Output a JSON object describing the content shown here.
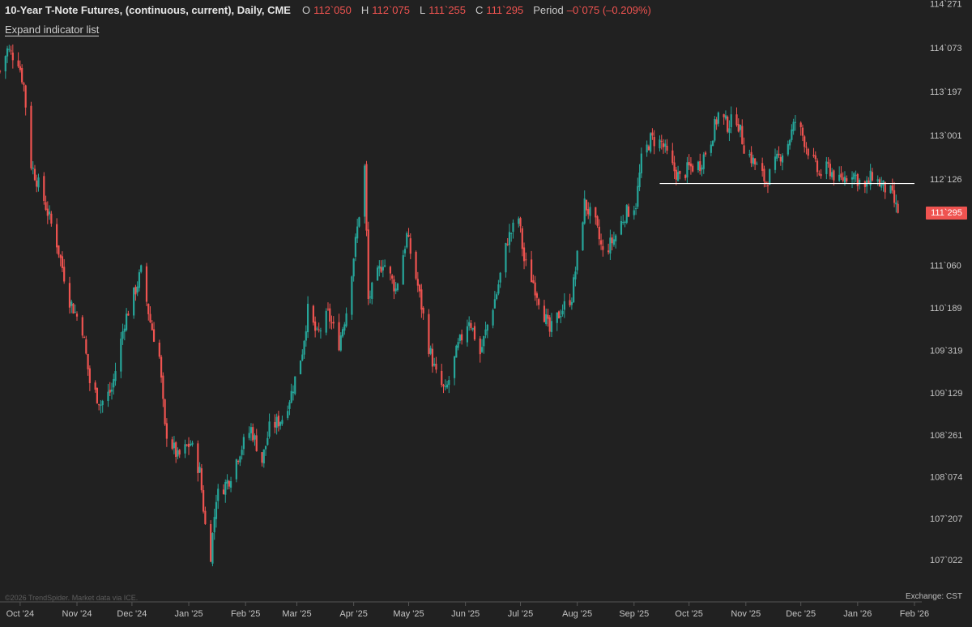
{
  "header": {
    "title": "10-Year T-Note Futures, (continuous, current), Daily, CME",
    "open_label": "O",
    "open_value": "112`050",
    "high_label": "H",
    "high_value": "112`075",
    "low_label": "L",
    "low_value": "111`255",
    "close_label": "C",
    "close_value": "111`295",
    "period_label": "Period",
    "period_value": "–0`075 (–0.209%)"
  },
  "toolbar": {
    "expand_label": "Expand indicator list"
  },
  "footer": {
    "copyright": "©2026 TrendSpider. Market data via ICE.",
    "exchange": "Exchange: CST"
  },
  "colors": {
    "background": "#212121",
    "up": "#26a69a",
    "down": "#ef5350",
    "grid_text": "#c4c4c4",
    "axis_line": "#555555",
    "support_line": "#ffffff"
  },
  "chart_data": {
    "type": "candlestick",
    "instrument": "10-Year T-Note Futures, (continuous, current), Daily, CME",
    "price_format": "points`32nds",
    "ylim": [
      106.9,
      114.42
    ],
    "y_ticks": [
      "114`271",
      "114`073",
      "113`197",
      "113`001",
      "112`126",
      "111`060",
      "110`189",
      "109`319",
      "109`129",
      "108`261",
      "108`074",
      "107`207",
      "107`022"
    ],
    "x_ticks": [
      "Oct '24",
      "Nov '24",
      "Dec '24",
      "Jan '25",
      "Feb '25",
      "Mar '25",
      "Apr '25",
      "May '25",
      "Jun '25",
      "Jul '25",
      "Aug '25",
      "Sep '25",
      "Oct '25",
      "Nov '25",
      "Dec '25",
      "Jan '26",
      "Feb '26"
    ],
    "x_range": [
      "2024-09-20",
      "2026-02-05"
    ],
    "last_price": "111`295",
    "last_price_value": 111.92,
    "support_line": {
      "price": 112.33,
      "from": "2025-09-15",
      "to": "2026-02-01"
    },
    "close_path": [
      [
        "2024-09-20",
        113.9
      ],
      [
        "2024-09-24",
        114.2
      ],
      [
        "2024-09-30",
        114.05
      ],
      [
        "2024-10-03",
        113.7
      ],
      [
        "2024-10-07",
        112.6
      ],
      [
        "2024-10-14",
        112.1
      ],
      [
        "2024-10-21",
        111.5
      ],
      [
        "2024-10-28",
        110.7
      ],
      [
        "2024-11-04",
        110.3
      ],
      [
        "2024-11-08",
        109.55
      ],
      [
        "2024-11-14",
        109.25
      ],
      [
        "2024-11-20",
        109.45
      ],
      [
        "2024-11-27",
        110.4
      ],
      [
        "2024-12-03",
        110.85
      ],
      [
        "2024-12-06",
        111.1
      ],
      [
        "2024-12-11",
        110.4
      ],
      [
        "2024-12-16",
        109.9
      ],
      [
        "2024-12-19",
        108.9
      ],
      [
        "2024-12-26",
        108.5
      ],
      [
        "2025-01-02",
        108.7
      ],
      [
        "2025-01-07",
        108.3
      ],
      [
        "2025-01-10",
        107.55
      ],
      [
        "2025-01-13",
        107.15
      ],
      [
        "2025-01-16",
        107.95
      ],
      [
        "2025-01-23",
        108.2
      ],
      [
        "2025-01-29",
        108.6
      ],
      [
        "2025-02-04",
        108.9
      ],
      [
        "2025-02-10",
        108.45
      ],
      [
        "2025-02-14",
        108.9
      ],
      [
        "2025-02-21",
        109.05
      ],
      [
        "2025-02-26",
        109.4
      ],
      [
        "2025-03-04",
        110.0
      ],
      [
        "2025-03-07",
        110.55
      ],
      [
        "2025-03-12",
        110.2
      ],
      [
        "2025-03-18",
        110.5
      ],
      [
        "2025-03-24",
        110.1
      ],
      [
        "2025-03-28",
        110.55
      ],
      [
        "2025-04-03",
        111.7
      ],
      [
        "2025-04-07",
        112.55
      ],
      [
        "2025-04-09",
        110.7
      ],
      [
        "2025-04-14",
        111.05
      ],
      [
        "2025-04-17",
        111.25
      ],
      [
        "2025-04-24",
        110.85
      ],
      [
        "2025-04-30",
        111.6
      ],
      [
        "2025-05-06",
        110.9
      ],
      [
        "2025-05-12",
        110.05
      ],
      [
        "2025-05-16",
        109.65
      ],
      [
        "2025-05-21",
        109.4
      ],
      [
        "2025-05-28",
        110.05
      ],
      [
        "2025-06-03",
        110.45
      ],
      [
        "2025-06-09",
        109.95
      ],
      [
        "2025-06-13",
        110.35
      ],
      [
        "2025-06-18",
        110.8
      ],
      [
        "2025-06-24",
        111.55
      ],
      [
        "2025-06-30",
        111.85
      ],
      [
        "2025-07-03",
        111.25
      ],
      [
        "2025-07-08",
        110.95
      ],
      [
        "2025-07-14",
        110.5
      ],
      [
        "2025-07-17",
        110.25
      ],
      [
        "2025-07-23",
        110.55
      ],
      [
        "2025-07-29",
        110.75
      ],
      [
        "2025-08-01",
        111.3
      ],
      [
        "2025-08-05",
        112.05
      ],
      [
        "2025-08-11",
        111.75
      ],
      [
        "2025-08-15",
        111.35
      ],
      [
        "2025-08-21",
        111.55
      ],
      [
        "2025-08-27",
        111.9
      ],
      [
        "2025-09-02",
        112.05
      ],
      [
        "2025-09-05",
        112.65
      ],
      [
        "2025-09-10",
        112.95
      ],
      [
        "2025-09-16",
        112.9
      ],
      [
        "2025-09-22",
        112.55
      ],
      [
        "2025-09-26",
        112.4
      ],
      [
        "2025-10-01",
        112.55
      ],
      [
        "2025-10-07",
        112.6
      ],
      [
        "2025-10-13",
        112.95
      ],
      [
        "2025-10-17",
        113.3
      ],
      [
        "2025-10-22",
        113.15
      ],
      [
        "2025-10-27",
        113.25
      ],
      [
        "2025-10-31",
        112.85
      ],
      [
        "2025-11-06",
        112.6
      ],
      [
        "2025-11-12",
        112.35
      ],
      [
        "2025-11-18",
        112.65
      ],
      [
        "2025-11-24",
        112.9
      ],
      [
        "2025-11-28",
        113.2
      ],
      [
        "2025-12-02",
        113.0
      ],
      [
        "2025-12-05",
        112.8
      ],
      [
        "2025-12-11",
        112.45
      ],
      [
        "2025-12-16",
        112.55
      ],
      [
        "2025-12-22",
        112.35
      ],
      [
        "2025-12-29",
        112.5
      ],
      [
        "2026-01-05",
        112.25
      ],
      [
        "2026-01-09",
        112.45
      ],
      [
        "2026-01-14",
        112.3
      ],
      [
        "2026-01-19",
        112.2
      ],
      [
        "2026-01-23",
        111.92
      ]
    ]
  }
}
